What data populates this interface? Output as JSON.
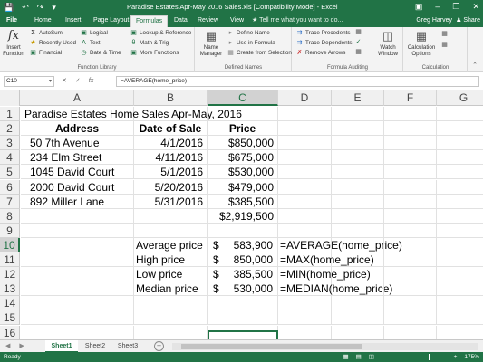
{
  "window": {
    "title": "Paradise Estates  Apr-May 2016 Sales.xls  [Compatibility Mode] - Excel",
    "qat": [
      "save-icon",
      "undo-icon",
      "redo-icon",
      "customize-icon"
    ],
    "controls": [
      "ribbon-display-icon",
      "minimize-icon",
      "restore-icon",
      "close-icon"
    ]
  },
  "tabs": {
    "file": "File",
    "items": [
      "Home",
      "Insert",
      "Page Layout",
      "Formulas",
      "Data",
      "Review",
      "View"
    ],
    "active": "Formulas",
    "tell_me": "Tell me what you want to do...",
    "user": "Greg Harvey",
    "share": "Share"
  },
  "ribbon": {
    "function_library": {
      "label": "Function Library",
      "insert_function": "Insert Function",
      "autosum": "AutoSum",
      "recently_used": "Recently Used",
      "financial": "Financial",
      "logical": "Logical",
      "text": "Text",
      "date_time": "Date & Time",
      "lookup": "Lookup & Reference",
      "math": "Math & Trig",
      "more": "More Functions"
    },
    "defined_names": {
      "label": "Defined Names",
      "name_manager": "Name Manager",
      "define_name": "Define Name",
      "use_in_formula": "Use in Formula",
      "create_from_selection": "Create from Selection"
    },
    "formula_auditing": {
      "label": "Formula Auditing",
      "trace_precedents": "Trace Precedents",
      "trace_dependents": "Trace Dependents",
      "remove_arrows": "Remove Arrows",
      "watch_window": "Watch Window"
    },
    "calculation": {
      "label": "Calculation",
      "options": "Calculation Options"
    }
  },
  "formula_bar": {
    "name_box": "C10",
    "formula": "=AVERAGE(home_price)"
  },
  "columns": [
    "A",
    "B",
    "C",
    "D",
    "E",
    "F",
    "G"
  ],
  "selected_column": "C",
  "selected_row": "10",
  "rows": [
    {
      "n": "1",
      "a": "Paradise Estates Home Sales Apr-May, 2016",
      "b": "",
      "c": "",
      "d": ""
    },
    {
      "n": "2",
      "a": "Address",
      "b": "Date of Sale",
      "c": "Price",
      "d": ""
    },
    {
      "n": "3",
      "a": "50 7th Avenue",
      "b": "4/1/2016",
      "c": "$850,000",
      "d": ""
    },
    {
      "n": "4",
      "a": "234 Elm Street",
      "b": "4/11/2016",
      "c": "$675,000",
      "d": ""
    },
    {
      "n": "5",
      "a": "1045 David Court",
      "b": "5/1/2016",
      "c": "$530,000",
      "d": ""
    },
    {
      "n": "6",
      "a": "2000 David Court",
      "b": "5/20/2016",
      "c": "$479,000",
      "d": ""
    },
    {
      "n": "7",
      "a": "892 Miller Lane",
      "b": "5/31/2016",
      "c": "$385,500",
      "d": ""
    },
    {
      "n": "8",
      "a": "",
      "b": "",
      "c": "$2,919,500",
      "d": ""
    },
    {
      "n": "9",
      "a": "",
      "b": "",
      "c": "",
      "d": ""
    },
    {
      "n": "10",
      "a": "",
      "b": "Average price",
      "c_sym": "$",
      "c_amt": "583,900",
      "d": "=AVERAGE(home_price)"
    },
    {
      "n": "11",
      "a": "",
      "b": "High price",
      "c_sym": "$",
      "c_amt": "850,000",
      "d": "=MAX(home_price)"
    },
    {
      "n": "12",
      "a": "",
      "b": "Low price",
      "c_sym": "$",
      "c_amt": "385,500",
      "d": "=MIN(home_price)"
    },
    {
      "n": "13",
      "a": "",
      "b": "Median price",
      "c_sym": "$",
      "c_amt": "530,000",
      "d": "=MEDIAN(home_price)"
    },
    {
      "n": "14",
      "a": "",
      "b": "",
      "c": "",
      "d": ""
    },
    {
      "n": "15",
      "a": "",
      "b": "",
      "c": "",
      "d": ""
    },
    {
      "n": "16",
      "a": "",
      "b": "",
      "c": "",
      "d": ""
    }
  ],
  "sheets": [
    "Sheet1",
    "Sheet2",
    "Sheet3"
  ],
  "active_sheet": "Sheet1",
  "status": {
    "ready": "Ready",
    "zoom": "175%"
  },
  "colors": {
    "accent": "#217346",
    "ribbon_bg": "#f3f3f3",
    "header_bg": "#f0f0f0"
  }
}
